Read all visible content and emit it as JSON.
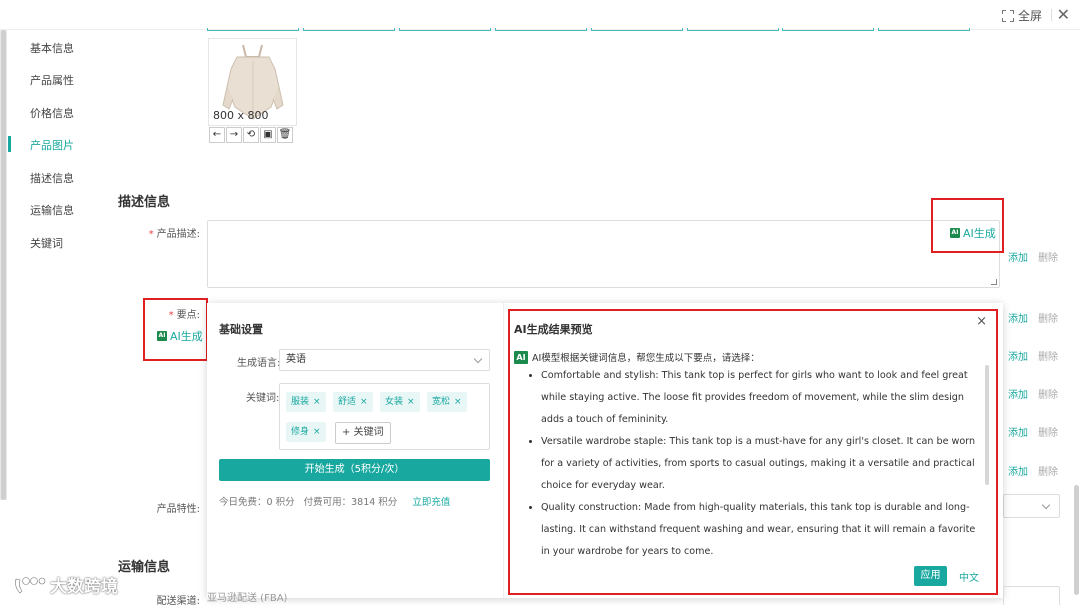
{
  "topbar": {
    "fullscreen_label": "全屏",
    "close_symbol": "✕"
  },
  "sidebar": {
    "items": [
      {
        "label": "基本信息",
        "active": false
      },
      {
        "label": "产品属性",
        "active": false
      },
      {
        "label": "价格信息",
        "active": false
      },
      {
        "label": "产品图片",
        "active": true
      },
      {
        "label": "描述信息",
        "active": false
      },
      {
        "label": "运输信息",
        "active": false
      },
      {
        "label": "关键词",
        "active": false
      }
    ],
    "accent_color": "#19a8a0"
  },
  "product_image": {
    "size_label": "800 x 800",
    "tools": [
      "arrow-left-icon",
      "arrow-right-icon",
      "rotate-icon",
      "image-icon",
      "trash-icon"
    ]
  },
  "description_section": {
    "title": "描述信息",
    "product_desc_label": "产品描述:",
    "ai_generate_label": "AI生成",
    "key_points_label": "要点:",
    "product_feature_label": "产品特性:"
  },
  "row_actions": {
    "add": "添加",
    "delete": "删除"
  },
  "ai_panel": {
    "settings": {
      "title": "基础设置",
      "language_label": "生成语言:",
      "language_value": "英语",
      "keywords_label": "关键词:",
      "keywords": [
        "服装",
        "舒适",
        "女装",
        "宽松",
        "修身"
      ],
      "add_keyword_label": "+ 关键词",
      "generate_button": "开始生成（5积分/次）",
      "free_today": "今日免费：0 积分",
      "paid_available": "付费可用：3814 积分",
      "recharge_link": "立即充值"
    },
    "preview": {
      "title": "AI生成结果预览",
      "badge": "AI",
      "intro": "AI模型根据关键词信息，帮您生成以下要点，请选择：",
      "points": [
        "Comfortable and stylish: This tank top is perfect for girls who want to look and feel great while staying active. The loose fit provides freedom of movement, while the slim design adds a touch of femininity.",
        "Versatile wardrobe staple: This tank top is a must-have for any girl's closet. It can be worn for a variety of activities, from sports to casual outings, making it a versatile and practical choice for everyday wear.",
        "Quality construction: Made from high-quality materials, this tank top is durable and long-lasting. It can withstand frequent washing and wear, ensuring that it will remain a favorite in your wardrobe for years to come."
      ],
      "apply_button": "应用",
      "chinese_link": "中文",
      "close_symbol": "×"
    }
  },
  "shipping_section": {
    "title": "运输信息",
    "channel_label": "配送渠道:",
    "channel_value": "亚马逊配送 (FBA)"
  },
  "watermark": {
    "text": "大数跨境"
  }
}
